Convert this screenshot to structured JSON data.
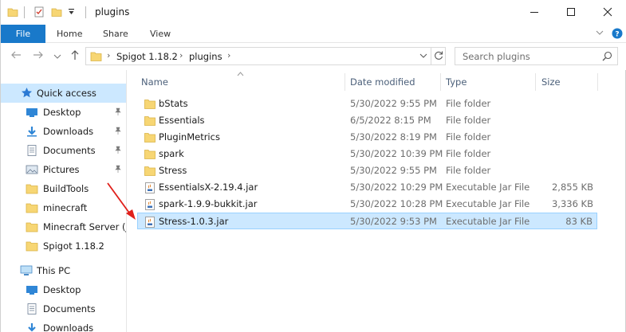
{
  "window": {
    "title": "plugins",
    "minimize_glyph": "—",
    "maximize_glyph": "☐",
    "close_glyph": "✕"
  },
  "ribbon": {
    "tabs": [
      "File",
      "Home",
      "Share",
      "View"
    ],
    "expand_glyph": "⌄",
    "help_glyph": "?"
  },
  "address": {
    "back_glyph": "←",
    "forward_glyph": "→",
    "recent_glyph": "⌄",
    "up_glyph": "↑",
    "crumbs": [
      "Spigot 1.18.2",
      "plugins"
    ],
    "refresh_glyph": "↻"
  },
  "search": {
    "placeholder": "Search plugins"
  },
  "navpane": {
    "quick_access": "Quick access",
    "items": [
      {
        "label": "Desktop",
        "icon": "desktop-icon",
        "pinned": true
      },
      {
        "label": "Downloads",
        "icon": "downloads-icon",
        "pinned": true
      },
      {
        "label": "Documents",
        "icon": "documents-icon",
        "pinned": true
      },
      {
        "label": "Pictures",
        "icon": "pictures-icon",
        "pinned": true
      },
      {
        "label": "BuildTools",
        "icon": "folder-icon",
        "pinned": false
      },
      {
        "label": "minecraft",
        "icon": "folder-icon",
        "pinned": false
      },
      {
        "label": "Minecraft Server (Ja",
        "icon": "folder-icon",
        "pinned": false
      },
      {
        "label": "Spigot 1.18.2",
        "icon": "folder-icon",
        "pinned": false
      }
    ],
    "this_pc": "This PC",
    "pc_items": [
      {
        "label": "Desktop",
        "icon": "desktop-icon"
      },
      {
        "label": "Documents",
        "icon": "documents-icon"
      },
      {
        "label": "Downloads",
        "icon": "downloads-icon"
      }
    ],
    "pin_glyph": "📌"
  },
  "columns": {
    "name": "Name",
    "date": "Date modified",
    "type": "Type",
    "size": "Size",
    "sort_glyph": "^"
  },
  "files": [
    {
      "name": "bStats",
      "date": "5/30/2022 9:55 PM",
      "type": "File folder",
      "size": "",
      "kind": "folder"
    },
    {
      "name": "Essentials",
      "date": "6/5/2022 8:15 PM",
      "type": "File folder",
      "size": "",
      "kind": "folder"
    },
    {
      "name": "PluginMetrics",
      "date": "5/30/2022 8:19 PM",
      "type": "File folder",
      "size": "",
      "kind": "folder"
    },
    {
      "name": "spark",
      "date": "5/30/2022 10:39 PM",
      "type": "File folder",
      "size": "",
      "kind": "folder"
    },
    {
      "name": "Stress",
      "date": "5/30/2022 9:55 PM",
      "type": "File folder",
      "size": "",
      "kind": "folder"
    },
    {
      "name": "EssentialsX-2.19.4.jar",
      "date": "5/30/2022 10:29 PM",
      "type": "Executable Jar File",
      "size": "2,855 KB",
      "kind": "jar"
    },
    {
      "name": "spark-1.9.9-bukkit.jar",
      "date": "5/30/2022 10:28 PM",
      "type": "Executable Jar File",
      "size": "3,336 KB",
      "kind": "jar"
    },
    {
      "name": "Stress-1.0.3.jar",
      "date": "5/30/2022 9:53 PM",
      "type": "Executable Jar File",
      "size": "83 KB",
      "kind": "jar",
      "selected": true
    }
  ],
  "colors": {
    "accent": "#1979ca",
    "selection": "#cce8ff",
    "folder": "#f7d674",
    "annotation_arrow": "#e0201b"
  }
}
